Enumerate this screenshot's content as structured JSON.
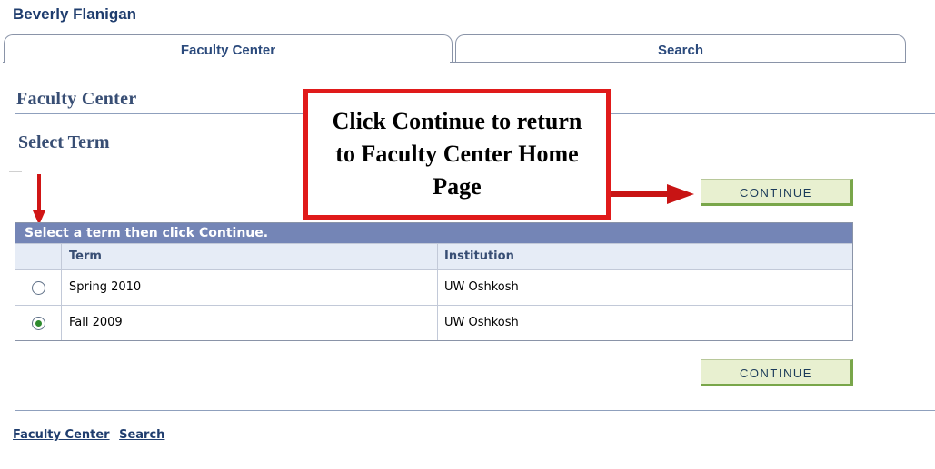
{
  "user": {
    "name": "Beverly Flanigan"
  },
  "tabs": [
    {
      "label": "Faculty Center",
      "active": true
    },
    {
      "label": "Search",
      "active": false
    }
  ],
  "page_title": "Faculty Center",
  "section_title": "Select Term",
  "callout": {
    "text": "Click Continue to return to Faculty Center Home Page"
  },
  "buttons": {
    "continue_top": "CONTINUE",
    "continue_bottom": "CONTINUE"
  },
  "grid": {
    "instruction": "Select a term then click Continue.",
    "columns": [
      "Term",
      "Institution"
    ],
    "rows": [
      {
        "term": "Spring 2010",
        "institution": "UW Oshkosh",
        "selected": false
      },
      {
        "term": "Fall 2009",
        "institution": "UW Oshkosh",
        "selected": true
      }
    ]
  },
  "footer": {
    "links": [
      "Faculty Center",
      "Search"
    ]
  },
  "colors": {
    "accent": "#7485b6",
    "callout_border": "#e01a1a",
    "button_bg": "#e8f0d0",
    "button_edge": "#79a64a"
  }
}
